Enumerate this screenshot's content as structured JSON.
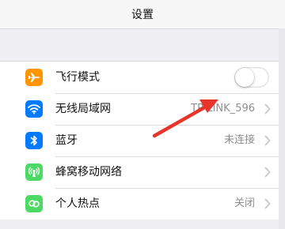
{
  "header": {
    "title": "设置"
  },
  "settings": {
    "items": [
      {
        "label": "飞行模式",
        "icon": "airplane-icon",
        "color": "#ff9500",
        "type": "toggle",
        "on": false
      },
      {
        "label": "无线局域网",
        "icon": "wifi-icon",
        "color": "#007aff",
        "type": "link",
        "value": "TP-LINK_596"
      },
      {
        "label": "蓝牙",
        "icon": "bluetooth-icon",
        "color": "#007aff",
        "type": "link",
        "value": "未连接"
      },
      {
        "label": "蜂窝移动网络",
        "icon": "cellular-icon",
        "color": "#4cd964",
        "type": "link",
        "value": ""
      },
      {
        "label": "个人热点",
        "icon": "hotspot-icon",
        "color": "#4cd964",
        "type": "link",
        "value": "关闭"
      }
    ]
  },
  "annotation": {
    "arrow_color": "#e8352b"
  }
}
